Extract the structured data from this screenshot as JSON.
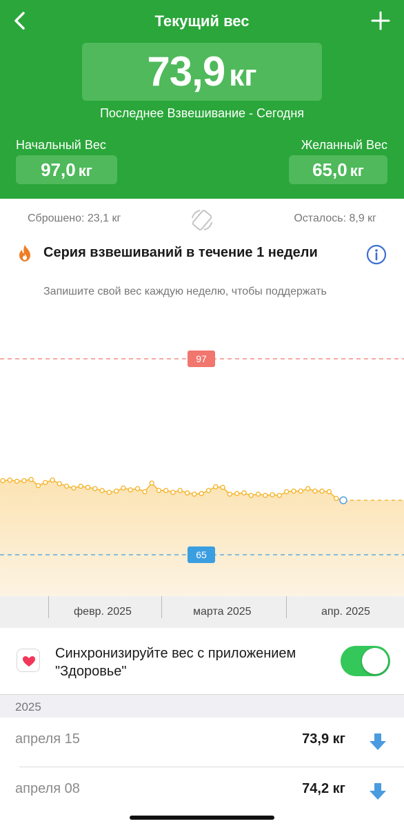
{
  "header": {
    "title": "Текущий вес",
    "current_weight": "73,9",
    "current_unit": "кг",
    "last_weigh_in": "Последнее Взвешивание - Сегодня",
    "start_label": "Начальный Вес",
    "start_value": "97,0",
    "start_unit": "кг",
    "goal_label": "Желанный Вес",
    "goal_value": "65,0",
    "goal_unit": "кг",
    "back_icon": "chevron-left-icon",
    "add_icon": "plus-icon"
  },
  "stats": {
    "lost": "Сброшено: 23,1 кг",
    "remaining": "Осталось: 8,9 кг"
  },
  "streak": {
    "title": "Серия взвешиваний в течение 1 недели",
    "description": "Запишите свой вес каждую неделю, чтобы поддержать свою серию"
  },
  "chart_data": {
    "type": "area",
    "start_line": {
      "label": "97",
      "value": 97,
      "color": "#f0766e"
    },
    "goal_line": {
      "label": "65",
      "value": 65,
      "color": "#3b9ee0"
    },
    "series_color": "#f5b52e",
    "x_labels": [
      "февр. 2025",
      "марта 2025",
      "апр. 2025"
    ],
    "values": [
      77.1,
      77.2,
      77.0,
      77.1,
      77.3,
      76.3,
      76.8,
      77.2,
      76.6,
      76.2,
      75.9,
      76.2,
      76.0,
      75.8,
      75.5,
      75.2,
      75.4,
      75.9,
      75.6,
      75.8,
      75.3,
      76.7,
      75.5,
      75.5,
      75.2,
      75.5,
      75.1,
      74.9,
      75.0,
      75.5,
      76.1,
      76.0,
      74.9,
      75.0,
      75.1,
      74.7,
      74.9,
      74.7,
      74.8,
      74.7,
      75.3,
      75.4,
      75.4,
      75.8,
      75.4,
      75.4,
      75.3,
      74.2,
      73.9
    ]
  },
  "sync": {
    "label": "Синхронизируйте вес с приложением \"Здоровье\"",
    "enabled": true
  },
  "log": {
    "year": "2025",
    "entries": [
      {
        "date": "апреля 15",
        "value": "73,9 кг",
        "trend": "down"
      },
      {
        "date": "апреля 08",
        "value": "74,2 кг",
        "trend": "down"
      }
    ]
  }
}
